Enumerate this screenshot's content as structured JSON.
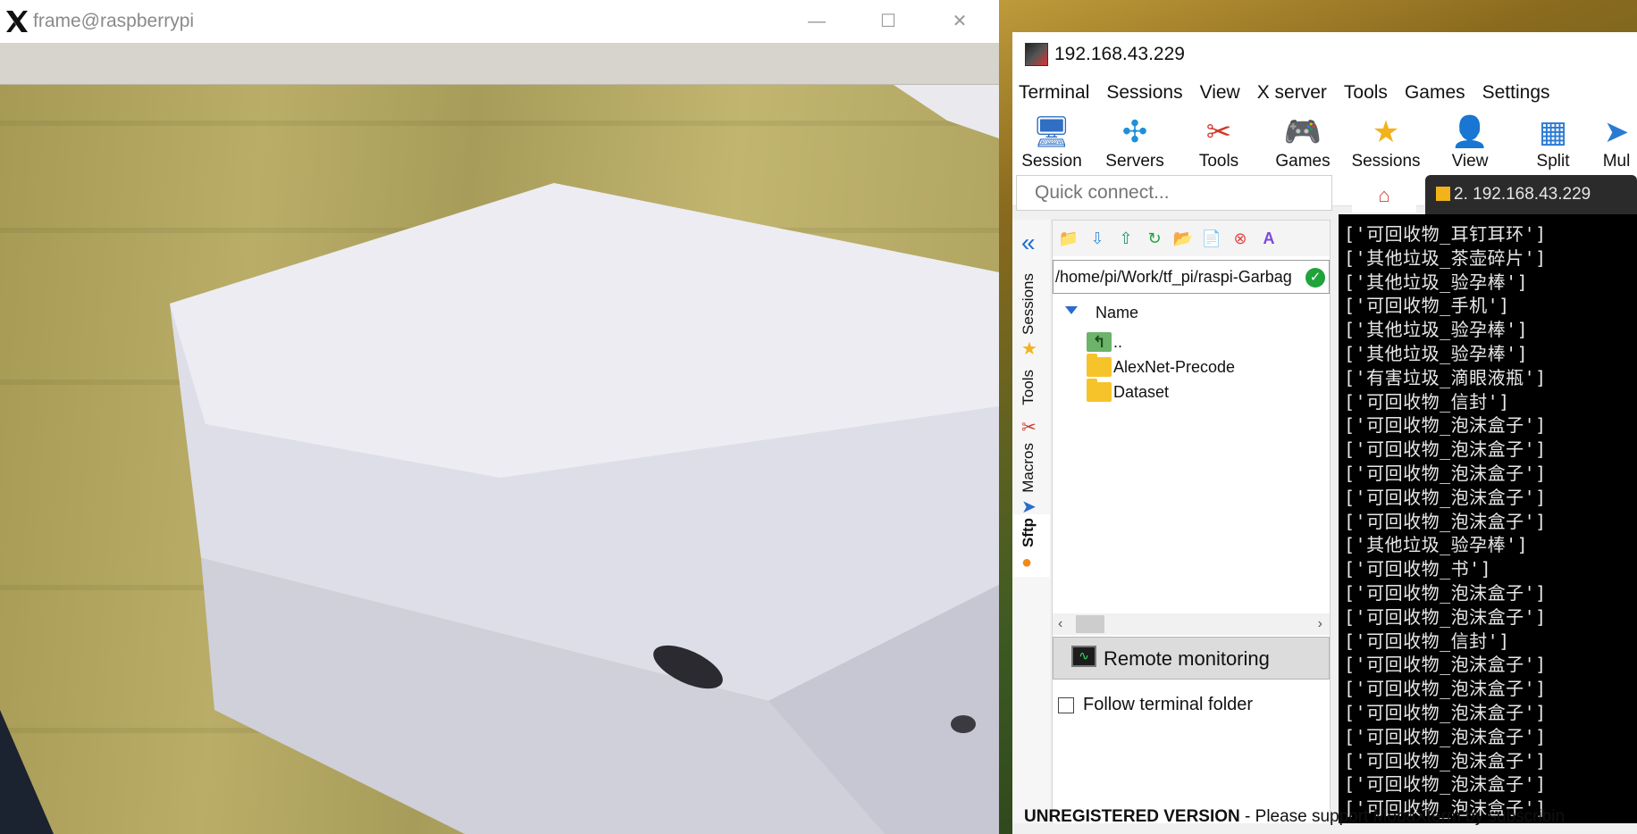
{
  "camera_window": {
    "title": "frame@raspberrypi",
    "controls": {
      "minimize": "—",
      "maximize": "☐",
      "close": "✕"
    }
  },
  "moba": {
    "title": "192.168.43.229",
    "menu": [
      "Terminal",
      "Sessions",
      "View",
      "X server",
      "Tools",
      "Games",
      "Settings"
    ],
    "toolbar": [
      {
        "label": "Session",
        "icon": "session-icon"
      },
      {
        "label": "Servers",
        "icon": "servers-icon"
      },
      {
        "label": "Tools",
        "icon": "tools-icon"
      },
      {
        "label": "Games",
        "icon": "games-icon"
      },
      {
        "label": "Sessions",
        "icon": "star-icon"
      },
      {
        "label": "View",
        "icon": "view-icon"
      },
      {
        "label": "Split",
        "icon": "split-icon"
      },
      {
        "label": "Mul",
        "icon": "multi-icon"
      }
    ],
    "quick_connect_placeholder": "Quick connect...",
    "active_tab": "2. 192.168.43.229",
    "side_tabs": [
      "Sessions",
      "Tools",
      "Macros",
      "Sftp"
    ],
    "sftp": {
      "path": "/home/pi/Work/tf_pi/raspi-Garbag",
      "column_name": "Name",
      "files": [
        {
          "name": "..",
          "type": "parent"
        },
        {
          "name": "AlexNet-Precode",
          "type": "folder"
        },
        {
          "name": "Dataset",
          "type": "folder"
        }
      ],
      "remote_monitoring": "Remote monitoring",
      "follow_terminal_folder": "Follow terminal folder",
      "follow_checked": false
    },
    "terminal_lines": [
      "['可回收物_耳钉耳环']",
      "['其他垃圾_茶壶碎片']",
      "['其他垃圾_验孕棒']",
      "['可回收物_手机']",
      "['其他垃圾_验孕棒']",
      "['其他垃圾_验孕棒']",
      "['有害垃圾_滴眼液瓶']",
      "['可回收物_信封']",
      "['可回收物_泡沫盒子']",
      "['可回收物_泡沫盒子']",
      "['可回收物_泡沫盒子']",
      "['可回收物_泡沫盒子']",
      "['可回收物_泡沫盒子']",
      "['其他垃圾_验孕棒']",
      "['可回收物_书']",
      "['可回收物_泡沫盒子']",
      "['可回收物_泡沫盒子']",
      "['可回收物_信封']",
      "['可回收物_泡沫盒子']",
      "['可回收物_泡沫盒子']",
      "['可回收物_泡沫盒子']",
      "['可回收物_泡沫盒子']",
      "['可回收物_泡沫盒子']",
      "['可回收物_泡沫盒子']",
      "['可回收物_泡沫盒子']"
    ],
    "status": {
      "strong": "UNREGISTERED VERSION",
      "rest": "  -  Please support MobaXterm by subscribin"
    }
  }
}
